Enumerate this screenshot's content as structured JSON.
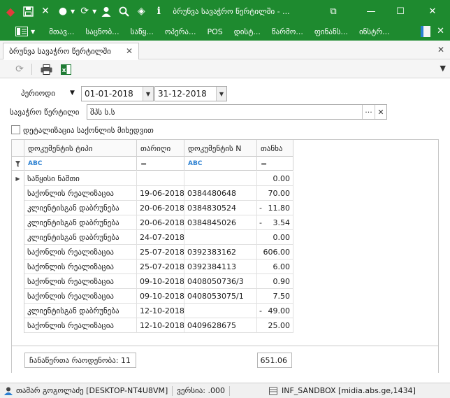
{
  "window": {
    "title": "ბრუნვა სავაჭრო წერტილში - ...",
    "controls": {
      "restore": "⧉",
      "minimize": "—",
      "maximize": "☐",
      "close": "✕"
    }
  },
  "menu": {
    "items": [
      "მთავ...",
      "საცნობ...",
      "საწყ...",
      "ოპერა...",
      "POS",
      "დისტ...",
      "წარმო...",
      "ფინანს...",
      "ინსტრ..."
    ]
  },
  "tab": {
    "label": "ბრუნვა სავაჭრო წერტილში",
    "close": "✕"
  },
  "filters": {
    "period_label": "პერიოდი",
    "date_from": "01-01-2018",
    "date_to": "31-12-2018",
    "point_label": "სავაჭრო წერტილი",
    "point_value": "შპს ს.ს",
    "point_browse": "···",
    "point_clear": "✕",
    "detail_label": "დეტალიზაცია საქონლის მიხედვით",
    "detail_checked": false
  },
  "grid": {
    "columns": [
      "დოკუმენტის ტიპი",
      "თარიღი",
      "დოკუმენტის N",
      "თანხა"
    ],
    "filter_row": [
      "ABC",
      "=",
      "ABC",
      "="
    ],
    "rows": [
      {
        "type": "საწყისი ნაშთი",
        "date": "",
        "doc": "",
        "amount": "0.00",
        "neg": false
      },
      {
        "type": "საქონლის რეალიზაცია",
        "date": "19-06-2018",
        "doc": "0384480648",
        "amount": "70.00",
        "neg": false
      },
      {
        "type": "კლიენტისგან დაბრუნება",
        "date": "20-06-2018",
        "doc": "0384830524",
        "amount": "11.80",
        "neg": true
      },
      {
        "type": "კლიენტისგან დაბრუნება",
        "date": "20-06-2018",
        "doc": "0384845026",
        "amount": "3.54",
        "neg": true
      },
      {
        "type": "კლიენტისგან დაბრუნება",
        "date": "24-07-2018",
        "doc": "",
        "amount": "0.00",
        "neg": false
      },
      {
        "type": "საქონლის რეალიზაცია",
        "date": "25-07-2018",
        "doc": "0392383162",
        "amount": "606.00",
        "neg": false
      },
      {
        "type": "საქონლის რეალიზაცია",
        "date": "25-07-2018",
        "doc": "0392384113",
        "amount": "6.00",
        "neg": false
      },
      {
        "type": "საქონლის რეალიზაცია",
        "date": "09-10-2018",
        "doc": "0408050736/3",
        "amount": "0.90",
        "neg": false
      },
      {
        "type": "საქონლის რეალიზაცია",
        "date": "09-10-2018",
        "doc": "0408053075/1",
        "amount": "7.50",
        "neg": false
      },
      {
        "type": "კლიენტისგან დაბრუნება",
        "date": "12-10-2018",
        "doc": "",
        "amount": "49.00",
        "neg": true
      },
      {
        "type": "საქონლის რეალიზაცია",
        "date": "12-10-2018",
        "doc": "0409628675",
        "amount": "25.00",
        "neg": false
      }
    ],
    "count_label": "ჩანაწერთა რაოდენობა: 11",
    "total": "651.06"
  },
  "status": {
    "user": "თამარ გოგოლაძე [DESKTOP-NT4U8VM]",
    "version": "ვერსია: .000",
    "db": "INF_SANDBOX [midia.abs.ge,1434]"
  },
  "icons": [
    "logo-icon",
    "save-icon",
    "tools-icon",
    "palette-icon",
    "refresh-icon",
    "user-icon",
    "search-icon",
    "diamond-icon",
    "info-icon",
    "print-icon",
    "excel-icon"
  ]
}
